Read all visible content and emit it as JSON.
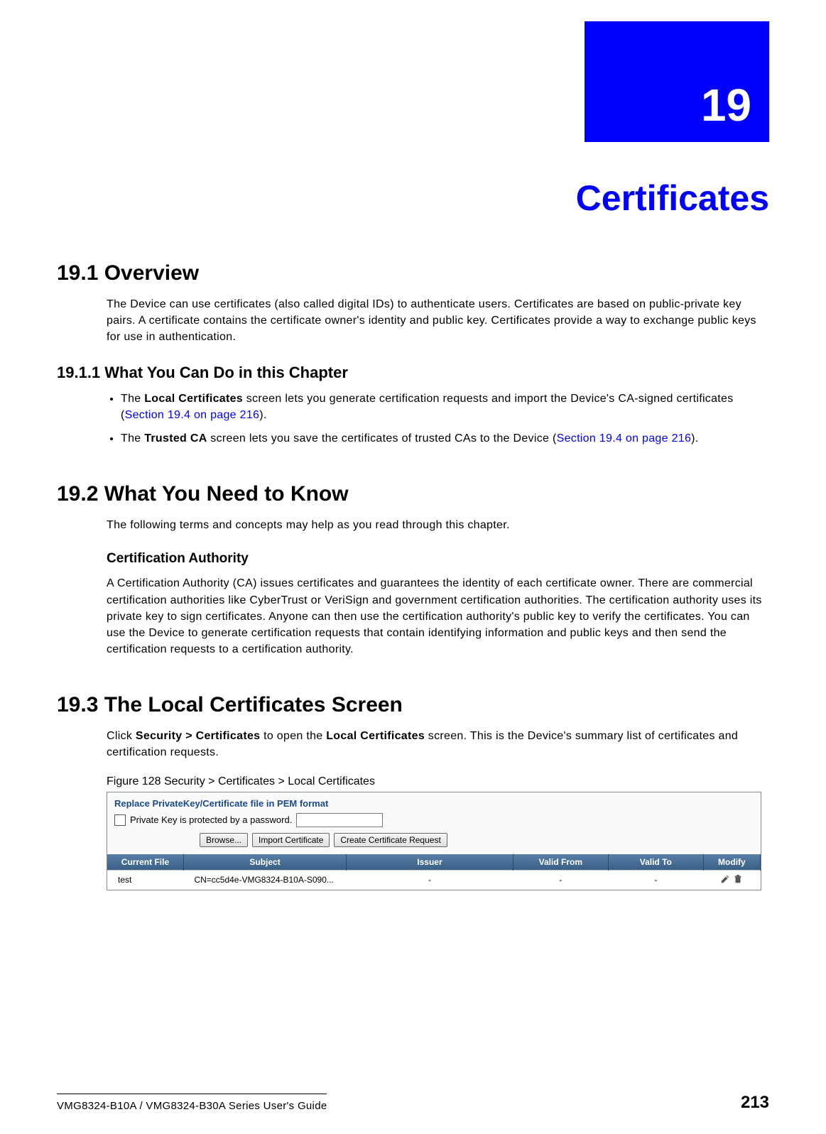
{
  "chapter": {
    "number": "19",
    "title": "Certificates"
  },
  "section_19_1": {
    "heading": "19.1  Overview",
    "body": "The Device can use certificates (also called digital IDs) to authenticate users. Certificates are based on public-private key pairs. A certificate contains the certificate owner's identity and public key. Certificates provide a way to exchange public keys for use in authentication."
  },
  "section_19_1_1": {
    "heading": "19.1.1  What You Can Do in this Chapter",
    "bullets": [
      {
        "prefix": "The ",
        "bold": "Local Certificates",
        "middle": " screen lets you generate certification requests and import the Device's CA-signed certificates (",
        "link": "Section 19.4 on page 216",
        "suffix": ")."
      },
      {
        "prefix": "The ",
        "bold": "Trusted CA",
        "middle": " screen lets you save the certificates of trusted CAs to the Device (",
        "link": "Section 19.4 on page 216",
        "suffix": ")."
      }
    ]
  },
  "section_19_2": {
    "heading": "19.2  What You Need to Know",
    "body": "The following terms and concepts may help as you read through this chapter.",
    "sub_heading": "Certification Authority",
    "sub_body": "A Certification Authority (CA) issues certificates and guarantees the identity of each certificate owner. There are commercial certification authorities like CyberTrust or VeriSign and government certification authorities. The certification authority uses its private key to sign certificates. Anyone can then use the certification authority's public key to verify the certificates. You can use the Device to generate certification requests that contain identifying information and public keys and then send the certification requests to a certification authority."
  },
  "section_19_3": {
    "heading": "19.3  The Local Certificates Screen",
    "body_pre": "Click ",
    "breadcrumb1": "Security > Certificates",
    "body_mid": " to open the ",
    "breadcrumb2": "Local Certificates",
    "body_post": " screen. This is the Device's summary list of certificates and certification requests.",
    "figure_caption": "Figure 128   Security > Certificates > Local Certificates"
  },
  "cert_panel": {
    "replace_label": "Replace PrivateKey/Certificate file in PEM format",
    "pw_label": "Private Key is protected by a password.",
    "browse_btn": "Browse...",
    "import_btn": "Import Certificate",
    "create_btn": "Create Certificate Request",
    "headers": [
      "Current File",
      "Subject",
      "Issuer",
      "Valid From",
      "Valid To",
      "Modify"
    ],
    "row": {
      "file": "test",
      "subject": "CN=cc5d4e-VMG8324-B10A-S090...",
      "issuer": "-",
      "valid_from": "-",
      "valid_to": "-"
    }
  },
  "footer": {
    "guide": "VMG8324-B10A / VMG8324-B30A Series User's Guide",
    "page": "213"
  }
}
